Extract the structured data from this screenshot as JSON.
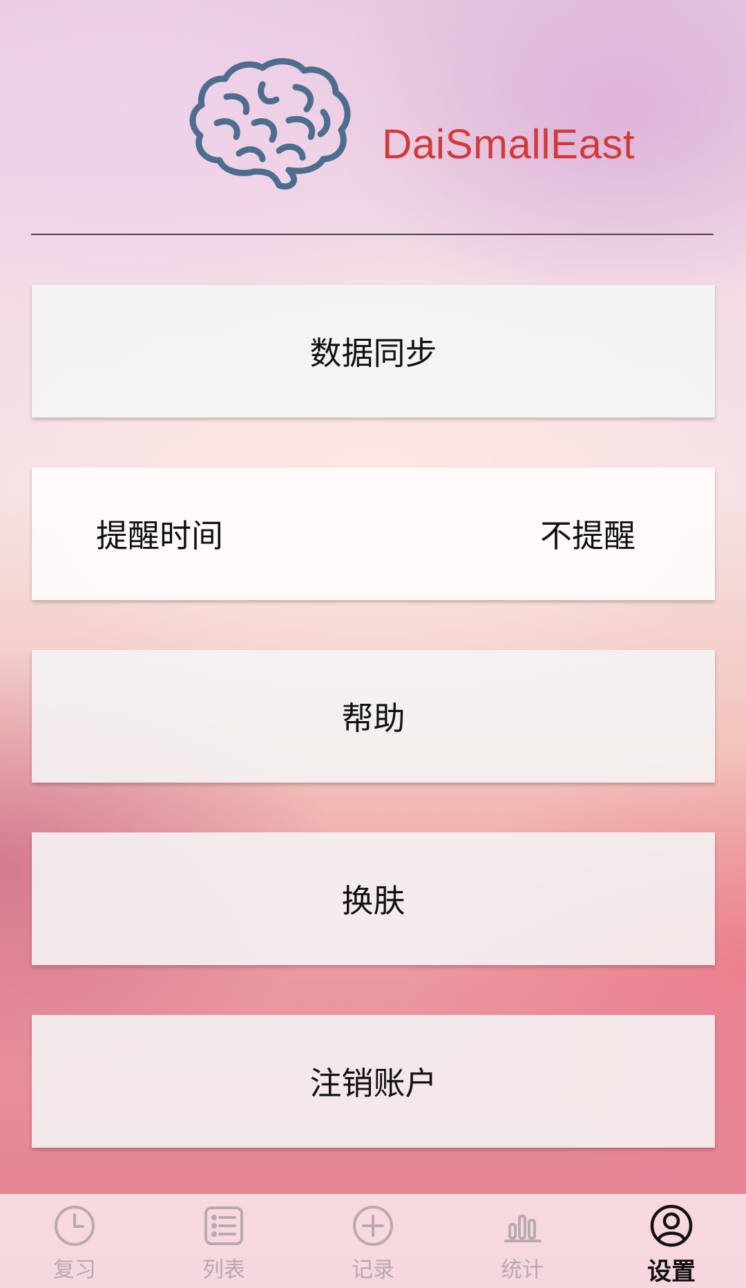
{
  "header": {
    "brand_name": "DaiSmallEast",
    "logo_icon": "brain-icon",
    "brand_color": "#d13a3a",
    "logo_color": "#4d6d8f"
  },
  "menu": {
    "data_sync": "数据同步",
    "reminder_label": "提醒时间",
    "reminder_value": "不提醒",
    "help": "帮助",
    "change_skin": "换肤",
    "delete_account": "注销账户"
  },
  "tabbar": {
    "items": [
      {
        "label": "复习",
        "icon": "clock-icon",
        "active": false
      },
      {
        "label": "列表",
        "icon": "list-icon",
        "active": false
      },
      {
        "label": "记录",
        "icon": "plus-circle-icon",
        "active": false
      },
      {
        "label": "统计",
        "icon": "bar-chart-icon",
        "active": false
      },
      {
        "label": "设置",
        "icon": "user-circle-icon",
        "active": true
      }
    ]
  }
}
